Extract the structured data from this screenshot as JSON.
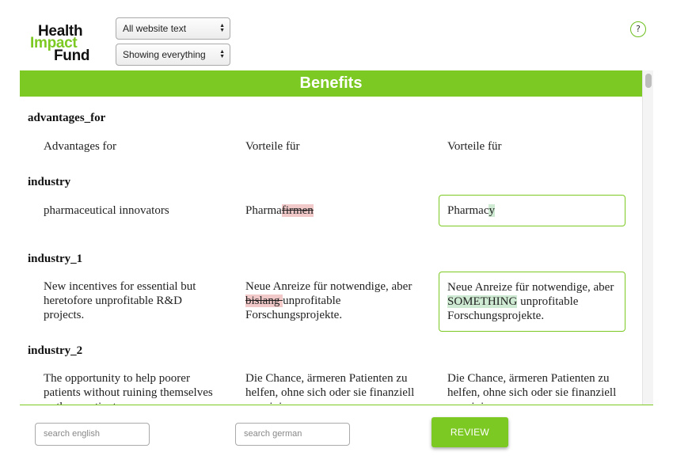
{
  "logo": {
    "line1": "Health",
    "line2": "Impact",
    "line3": "Fund"
  },
  "filters": {
    "scope_value": "All website text",
    "visibility_value": "Showing everything"
  },
  "help": {
    "label": "?"
  },
  "section": {
    "title": "Benefits"
  },
  "entries": [
    {
      "key": "advantages_for",
      "english": "Advantages for",
      "german": "Vorteile für",
      "edited": "Vorteile für"
    },
    {
      "key": "industry",
      "english": "pharmaceutical innovators",
      "german_plain": "Pharma",
      "german_deleted": "firmen",
      "edited_plain": "Pharmac",
      "edited_inserted": "y"
    },
    {
      "key": "industry_1",
      "english": "New incentives for essential but heretofore unprofitable R&D projects.",
      "german_before": "Neue Anreize für notwendige, aber ",
      "german_deleted": "bislang ",
      "german_after": "unprofitable Forschungsprojekte.",
      "edited_before": "Neue Anreize für notwendige, aber ",
      "edited_inserted": "SOMETHING",
      "edited_after": " unprofitable Forschungsprojekte."
    },
    {
      "key": "industry_2",
      "english": "The opportunity to help poorer patients without ruining themselves or these patients",
      "german": "Die Chance, ärmeren Patienten zu helfen, ohne sich oder sie finanziell zu ruinieren",
      "edited": "Die Chance, ärmeren Patienten zu helfen, ohne sich oder sie finanziell zu ruinieren"
    }
  ],
  "bottom": {
    "search_english_placeholder": "search english",
    "search_german_placeholder": "search german",
    "review_label": "REVIEW"
  },
  "colors": {
    "accent": "#7dc924",
    "deleted_bg": "#f2c9c9",
    "inserted_bg": "#cfead2"
  }
}
